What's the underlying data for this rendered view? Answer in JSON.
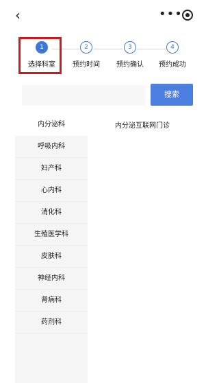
{
  "nav": {
    "back_icon": "chevron-left-icon",
    "more_icon": "more-dots-icon",
    "target_icon": "target-icon"
  },
  "steps": [
    {
      "number": "1",
      "label": "选择科室",
      "active": true
    },
    {
      "number": "2",
      "label": "预约时间",
      "active": false
    },
    {
      "number": "3",
      "label": "预约确认",
      "active": false
    },
    {
      "number": "4",
      "label": "预约成功",
      "active": false
    }
  ],
  "search": {
    "placeholder": "",
    "button_label": "搜索"
  },
  "departments": [
    "内分泌科",
    "呼吸内科",
    "妇产科",
    "心内科",
    "消化科",
    "生殖医学科",
    "皮肤科",
    "神经内科",
    "肾病科",
    "药剂科"
  ],
  "clinics": [
    "内分泌互联网门诊"
  ],
  "colors": {
    "accent": "#4c7fe0",
    "highlight": "#d0191d"
  }
}
